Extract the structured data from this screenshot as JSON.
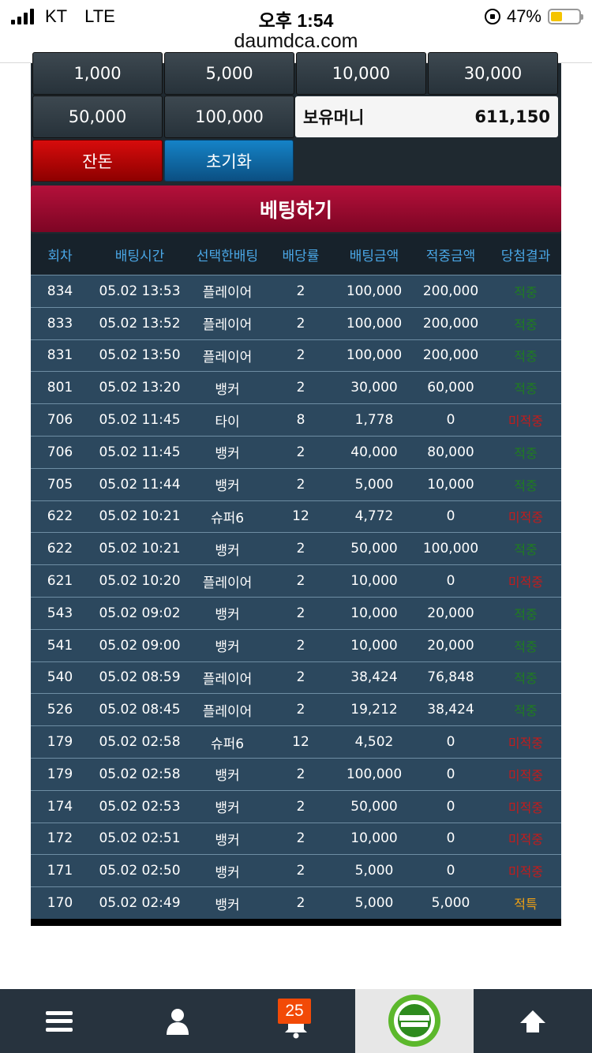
{
  "status_bar": {
    "carrier": "KT",
    "network": "LTE",
    "time": "오후 1:54",
    "battery": "47%"
  },
  "url": "daumdca.com",
  "chips": [
    "1,000",
    "5,000",
    "10,000",
    "30,000",
    "50,000",
    "100,000"
  ],
  "holding": {
    "label": "보유머니",
    "value": "611,150"
  },
  "buttons": {
    "change": "잔돈",
    "reset": "초기화",
    "bet": "베팅하기"
  },
  "table": {
    "headers": [
      "회차",
      "배팅시간",
      "선택한배팅",
      "배당률",
      "배팅금액",
      "적중금액",
      "당첨결과"
    ],
    "rows": [
      [
        "834",
        "05.02 13:53",
        "플레이어",
        "2",
        "100,000",
        "200,000",
        "적중"
      ],
      [
        "833",
        "05.02 13:52",
        "플레이어",
        "2",
        "100,000",
        "200,000",
        "적중"
      ],
      [
        "831",
        "05.02 13:50",
        "플레이어",
        "2",
        "100,000",
        "200,000",
        "적중"
      ],
      [
        "801",
        "05.02 13:20",
        "뱅커",
        "2",
        "30,000",
        "60,000",
        "적중"
      ],
      [
        "706",
        "05.02 11:45",
        "타이",
        "8",
        "1,778",
        "0",
        "미적중"
      ],
      [
        "706",
        "05.02 11:45",
        "뱅커",
        "2",
        "40,000",
        "80,000",
        "적중"
      ],
      [
        "705",
        "05.02 11:44",
        "뱅커",
        "2",
        "5,000",
        "10,000",
        "적중"
      ],
      [
        "622",
        "05.02 10:21",
        "슈퍼6",
        "12",
        "4,772",
        "0",
        "미적중"
      ],
      [
        "622",
        "05.02 10:21",
        "뱅커",
        "2",
        "50,000",
        "100,000",
        "적중"
      ],
      [
        "621",
        "05.02 10:20",
        "플레이어",
        "2",
        "10,000",
        "0",
        "미적중"
      ],
      [
        "543",
        "05.02 09:02",
        "뱅커",
        "2",
        "10,000",
        "20,000",
        "적중"
      ],
      [
        "541",
        "05.02 09:00",
        "뱅커",
        "2",
        "10,000",
        "20,000",
        "적중"
      ],
      [
        "540",
        "05.02 08:59",
        "플레이어",
        "2",
        "38,424",
        "76,848",
        "적중"
      ],
      [
        "526",
        "05.02 08:45",
        "플레이어",
        "2",
        "19,212",
        "38,424",
        "적중"
      ],
      [
        "179",
        "05.02 02:58",
        "슈퍼6",
        "12",
        "4,502",
        "0",
        "미적중"
      ],
      [
        "179",
        "05.02 02:58",
        "뱅커",
        "2",
        "100,000",
        "0",
        "미적중"
      ],
      [
        "174",
        "05.02 02:53",
        "뱅커",
        "2",
        "50,000",
        "0",
        "미적중"
      ],
      [
        "172",
        "05.02 02:51",
        "뱅커",
        "2",
        "10,000",
        "0",
        "미적중"
      ],
      [
        "171",
        "05.02 02:50",
        "뱅커",
        "2",
        "5,000",
        "0",
        "미적중"
      ],
      [
        "170",
        "05.02 02:49",
        "뱅커",
        "2",
        "5,000",
        "5,000",
        "적특"
      ]
    ]
  },
  "bottom_nav": {
    "notification_count": "25"
  },
  "icons": {
    "menu": "hamburger-menu-icon",
    "user": "user-icon",
    "bell": "bell-icon",
    "logo": "daumd-casino-logo",
    "up": "arrow-up-icon"
  },
  "colors": {
    "win": "#1f7d1f",
    "lose": "#c21c1c",
    "tie": "#f0a012",
    "header_text": "#4aa7e6",
    "badge": "#f24a07"
  }
}
